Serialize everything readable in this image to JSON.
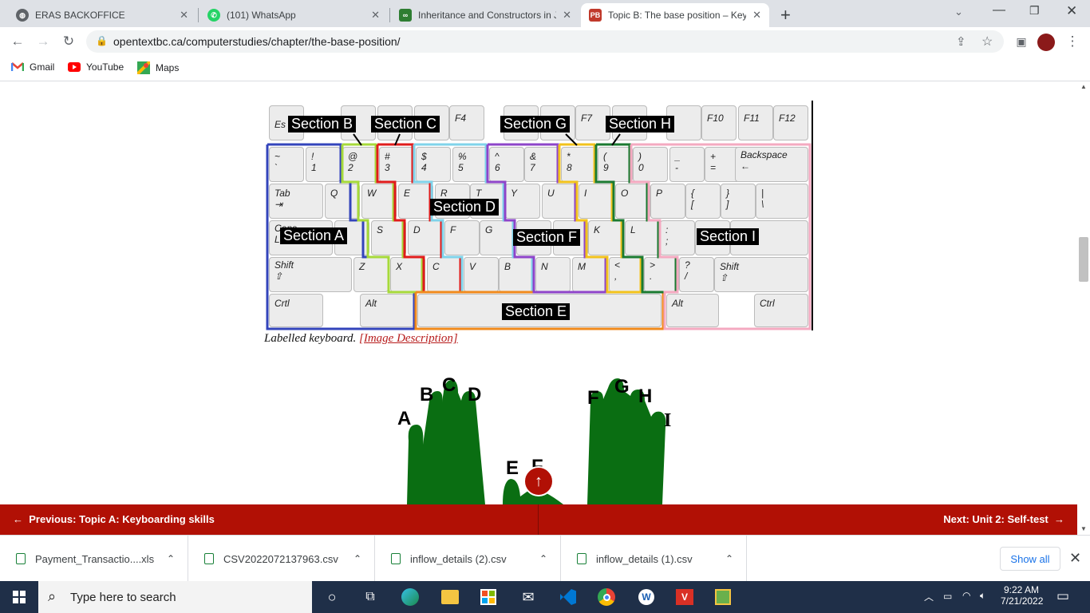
{
  "tabs": [
    {
      "title": "ERAS BACKOFFICE",
      "favicon": "globe-icon"
    },
    {
      "title": "(101) WhatsApp",
      "favicon": "whatsapp-icon"
    },
    {
      "title": "Inheritance and Constructors in J",
      "favicon": "site-icon"
    },
    {
      "title": "Topic B: The base position – Key",
      "favicon": "pressbooks-icon"
    }
  ],
  "new_tab": "+",
  "url": "opentextbc.ca/computerstudies/chapter/the-base-position/",
  "bookmarks": [
    {
      "label": "Gmail",
      "icon": "gmail-icon"
    },
    {
      "label": "YouTube",
      "icon": "youtube-icon"
    },
    {
      "label": "Maps",
      "icon": "maps-icon"
    }
  ],
  "keyboard": {
    "sections": [
      "Section A",
      "Section B",
      "Section C",
      "Section D",
      "Section E",
      "Section F",
      "Section G",
      "Section H",
      "Section I"
    ],
    "section_colors": {
      "A": "#3344bb",
      "B": "#a6d93a",
      "C": "#e01b1b",
      "D": "#7fd3ea",
      "E": "#f08a1c",
      "F": "#8e44c9",
      "G": "#f2c21b",
      "H": "#1a7a30",
      "I": "#f4a9c0"
    }
  },
  "caption": {
    "text": "Labelled keyboard.",
    "link": "[Image Description]"
  },
  "hands": {
    "letters": [
      "A",
      "B",
      "C",
      "D",
      "E",
      "F",
      "F",
      "G",
      "H",
      "I"
    ],
    "color": "#0a6e12"
  },
  "pager": {
    "prev": "Previous: Topic A: Keyboarding skills",
    "next": "Next: Unit 2: Self-test",
    "accent": "#b11005"
  },
  "downloads": [
    {
      "name": "Payment_Transactio....xls"
    },
    {
      "name": "CSV2022072137963.csv"
    },
    {
      "name": "inflow_details (2).csv"
    },
    {
      "name": "inflow_details (1).csv"
    }
  ],
  "show_all": "Show all",
  "taskbar": {
    "search_placeholder": "Type here to search",
    "time": "9:22 AM",
    "date": "7/21/2022"
  }
}
